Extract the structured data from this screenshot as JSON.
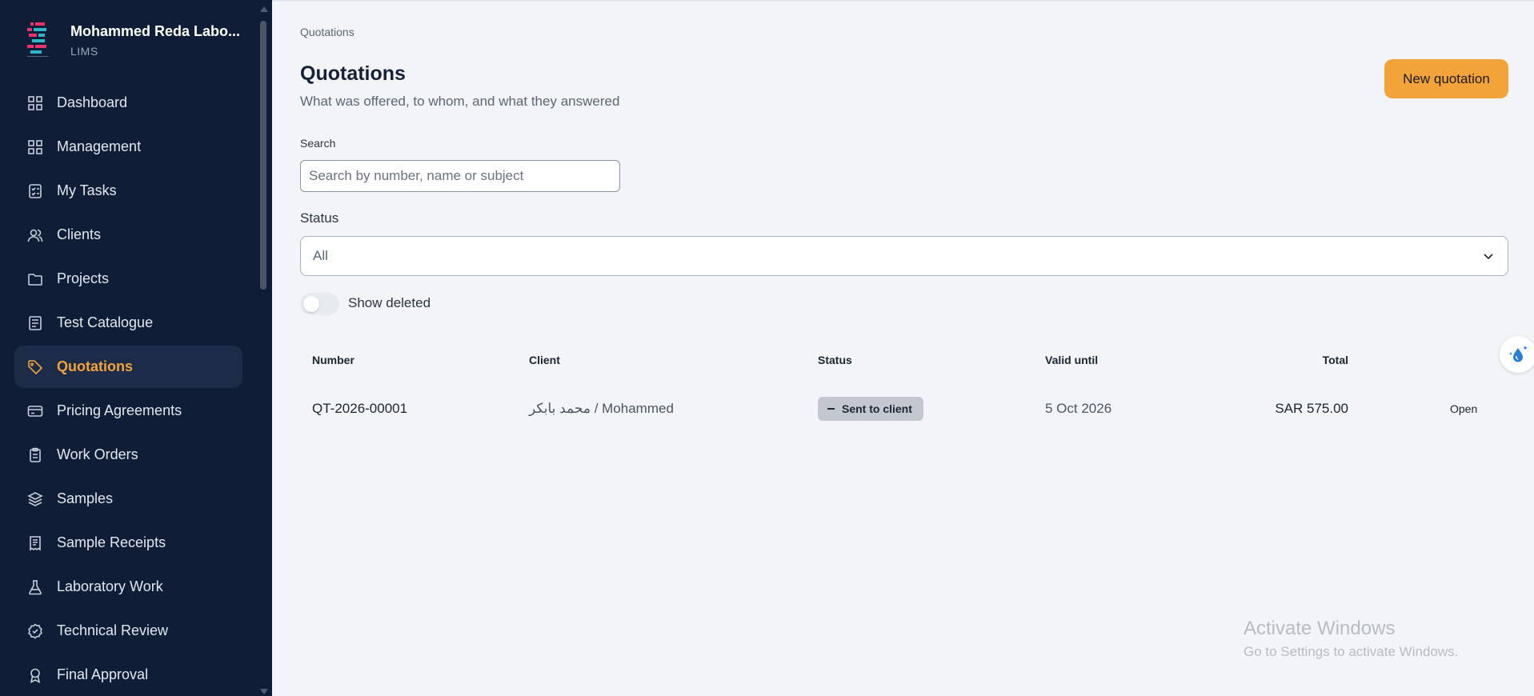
{
  "brand": {
    "name": "Mohammed Reda Labo...",
    "subtitle": "LIMS"
  },
  "sidebar": {
    "items": [
      {
        "label": "Dashboard",
        "icon": "grid-icon"
      },
      {
        "label": "Management",
        "icon": "grid-icon"
      },
      {
        "label": "My Tasks",
        "icon": "checklist-icon"
      },
      {
        "label": "Clients",
        "icon": "users-icon"
      },
      {
        "label": "Projects",
        "icon": "folder-icon"
      },
      {
        "label": "Test Catalogue",
        "icon": "document-icon"
      },
      {
        "label": "Quotations",
        "icon": "tag-icon",
        "active": true
      },
      {
        "label": "Pricing Agreements",
        "icon": "card-icon"
      },
      {
        "label": "Work Orders",
        "icon": "clipboard-icon"
      },
      {
        "label": "Samples",
        "icon": "layers-icon"
      },
      {
        "label": "Sample Receipts",
        "icon": "receipt-icon"
      },
      {
        "label": "Laboratory Work",
        "icon": "flask-icon"
      },
      {
        "label": "Technical Review",
        "icon": "badge-check-icon"
      },
      {
        "label": "Final Approval",
        "icon": "award-icon"
      }
    ]
  },
  "header": {
    "breadcrumb": "Quotations",
    "title": "Quotations",
    "subtitle": "What was offered, to whom, and what they answered",
    "new_button": "New quotation"
  },
  "filters": {
    "search_label": "Search",
    "search_placeholder": "Search by number, name or subject",
    "search_value": "",
    "status_label": "Status",
    "status_value": "All",
    "show_deleted_label": "Show deleted",
    "show_deleted": false
  },
  "table": {
    "columns": [
      "Number",
      "Client",
      "Status",
      "Valid until",
      "Total"
    ],
    "rows": [
      {
        "number": "QT-2026-00001",
        "client": "محمد بابكر / Mohammed",
        "status": "Sent to client",
        "valid_until": "5 Oct 2026",
        "total": "SAR 575.00",
        "action": "Open"
      }
    ]
  },
  "watermark": {
    "title": "Activate Windows",
    "subtitle": "Go to Settings to activate Windows."
  },
  "colors": {
    "sidebar_bg": "#0f1e36",
    "accent": "#f2a43a",
    "page_bg": "#f2f4f7"
  }
}
